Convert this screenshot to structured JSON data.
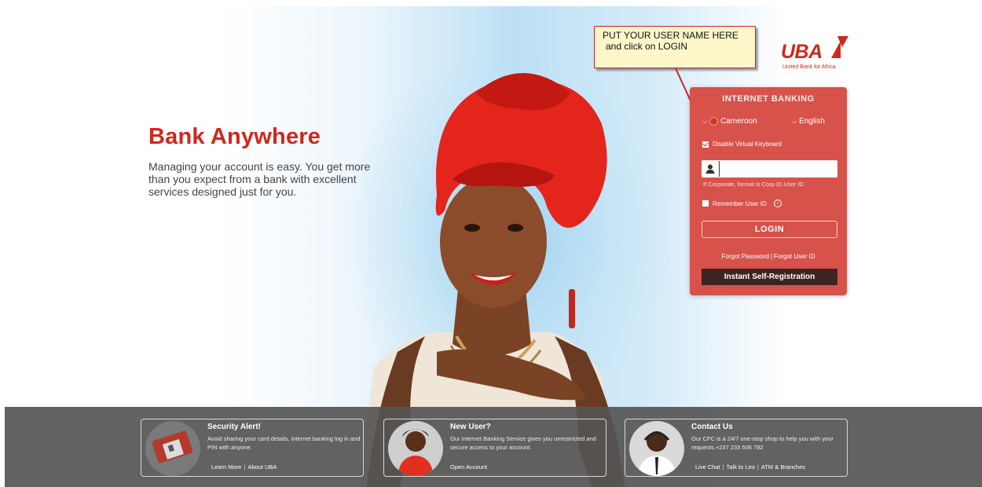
{
  "hero": {
    "title": "Bank Anywhere",
    "description": "Managing your account is easy. You get more than you expect from a bank with excellent services designed just for you."
  },
  "callout": {
    "line1": "PUT YOUR USER NAME HERE",
    "line2": "and click on LOGIN"
  },
  "logo": {
    "name": "UBA",
    "tagline": "United Bank for Africa"
  },
  "login": {
    "title": "INTERNET BANKING",
    "country": "Cameroon",
    "language": "English",
    "disable_keyboard_label": "Disable Virtual Keyboard",
    "disable_keyboard_checked": true,
    "user_id_value": "",
    "user_id_hint": "If Corporate, format is Corp ID.User ID",
    "remember_label": "Remember User ID",
    "remember_checked": false,
    "login_label": "LOGIN",
    "forgot_password": "Forgot Password",
    "forgot_user_id": "Forgot User ID",
    "self_registration": "Instant Self-Registration"
  },
  "footer": {
    "security": {
      "title": "Security Alert!",
      "text": "Avoid sharing your card details, internet banking log in and PIN with anyone.",
      "links": [
        "Learn More",
        "About UBA"
      ]
    },
    "new_user": {
      "title": "New User?",
      "text": "Our Internet Banking Service gives you unrestricted and secure access to your account.",
      "links": [
        "Open Account"
      ]
    },
    "contact": {
      "title": "Contact Us",
      "text": "Our CFC is a 24/7 one-stop shop to help you with your requests.+237 233 506 782",
      "links": [
        "Live Chat",
        "Talk to Leo",
        "ATM & Branches"
      ]
    }
  },
  "colors": {
    "brand_red": "#d0271d",
    "panel_red": "#d6524b",
    "registration_bg": "#3e2421",
    "footer_bg": "#555555"
  }
}
